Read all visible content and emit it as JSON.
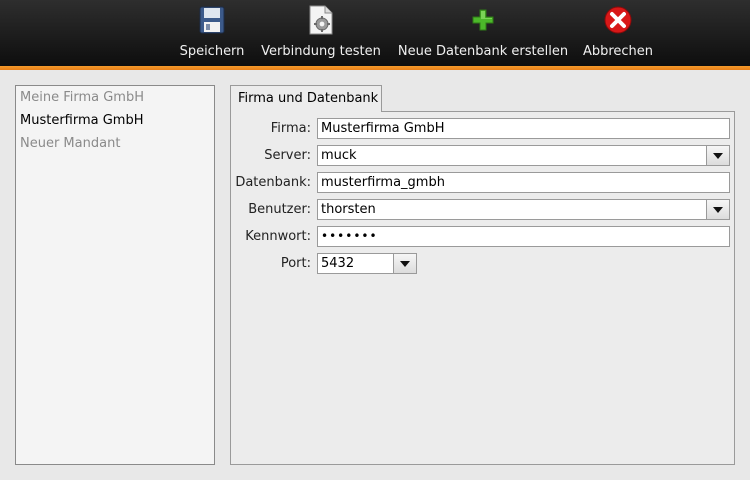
{
  "toolbar": {
    "save": {
      "label": "Speichern",
      "icon": "floppy-disk-icon"
    },
    "test": {
      "label": "Verbindung testen",
      "icon": "connection-gear-icon"
    },
    "new_db": {
      "label": "Neue Datenbank erstellen",
      "icon": "green-plus-icon"
    },
    "cancel": {
      "label": "Abbrechen",
      "icon": "red-x-icon"
    }
  },
  "clients": [
    {
      "label": "Meine Firma GmbH",
      "muted": true
    },
    {
      "label": "Musterfirma GmbH",
      "muted": false
    },
    {
      "label": "Neuer Mandant",
      "muted": true
    }
  ],
  "tab": {
    "label": "Firma und Datenbank"
  },
  "form": {
    "firma": {
      "label": "Firma:",
      "value": "Musterfirma GmbH"
    },
    "server": {
      "label": "Server:",
      "value": "muck"
    },
    "datenbank": {
      "label": "Datenbank:",
      "value": "musterfirma_gmbh"
    },
    "benutzer": {
      "label": "Benutzer:",
      "value": "thorsten"
    },
    "kennwort": {
      "label": "Kennwort:",
      "value": "•••••••"
    },
    "port": {
      "label": "Port:",
      "value": "5432"
    }
  },
  "colors": {
    "toolbar_bg": "#1a1a1a",
    "accent_orange": "#f0901f",
    "panel_bg": "#ececec"
  }
}
